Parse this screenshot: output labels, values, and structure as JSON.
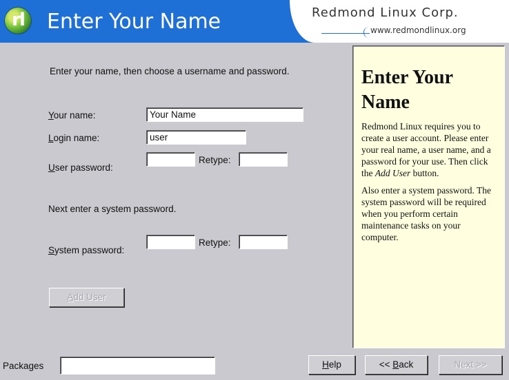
{
  "header": {
    "logo_text": "rl",
    "title": "Enter Your Name",
    "company": "Redmond Linux Corp.",
    "url": "www.redmondlinux.org"
  },
  "form": {
    "intro": "Enter your name, then choose a username and password.",
    "your_name_label_u": "Y",
    "your_name_label_rest": "our name:",
    "your_name_value": "Your Name",
    "login_name_label_u": "L",
    "login_name_label_rest": "ogin name:",
    "login_name_value": "user",
    "user_password_label_u": "U",
    "user_password_label_rest": "ser password:",
    "retype_label": "Retype:",
    "system_intro": "Next enter a system password.",
    "system_password_label_u": "S",
    "system_password_label_rest": "ystem password:",
    "add_user_button_u": "A",
    "add_user_button_rest": "dd User"
  },
  "help": {
    "title": "Enter Your Name",
    "p1_before": "Redmond Linux requires you to create a user account. Please enter your real name, a user name, and a password for your use. Then click the ",
    "p1_italic": "Add User",
    "p1_after": " button.",
    "p2": "Also enter a system password. The system password will be required when you perform certain maintenance tasks on your computer."
  },
  "footer": {
    "packages_label": "Packages",
    "packages_value": "",
    "help_button_u": "H",
    "help_button_rest": "elp",
    "back_button_prefix": "<< ",
    "back_button_u": "B",
    "back_button_rest": "ack",
    "next_button": "Next >>"
  }
}
